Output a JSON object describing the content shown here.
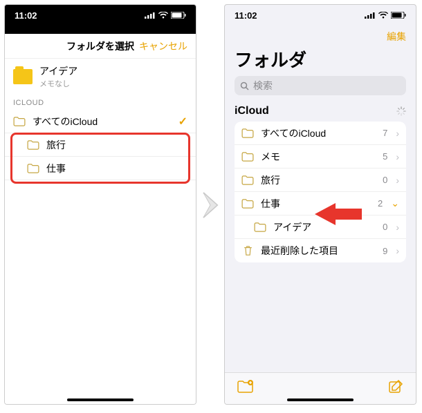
{
  "status": {
    "time": "11:02"
  },
  "left": {
    "modal_title": "フォルダを選択",
    "cancel": "キャンセル",
    "note": {
      "title": "アイデア",
      "subtitle": "メモなし"
    },
    "section": "ICLOUD",
    "root": {
      "label": "すべてのiCloud"
    },
    "children": [
      {
        "label": "旅行"
      },
      {
        "label": "仕事"
      }
    ]
  },
  "right": {
    "edit": "編集",
    "big_title": "フォルダ",
    "search_placeholder": "検索",
    "group": "iCloud",
    "rows": [
      {
        "label": "すべてのiCloud",
        "count": "7",
        "chev": "›",
        "indent": 0,
        "icon": "folder"
      },
      {
        "label": "メモ",
        "count": "5",
        "chev": "›",
        "indent": 0,
        "icon": "folder"
      },
      {
        "label": "旅行",
        "count": "0",
        "chev": "›",
        "indent": 0,
        "icon": "folder"
      },
      {
        "label": "仕事",
        "count": "2",
        "chev": "⌄",
        "indent": 0,
        "icon": "folder"
      },
      {
        "label": "アイデア",
        "count": "0",
        "chev": "›",
        "indent": 1,
        "icon": "folder"
      },
      {
        "label": "最近削除した項目",
        "count": "9",
        "chev": "›",
        "indent": 0,
        "icon": "trash"
      }
    ]
  }
}
